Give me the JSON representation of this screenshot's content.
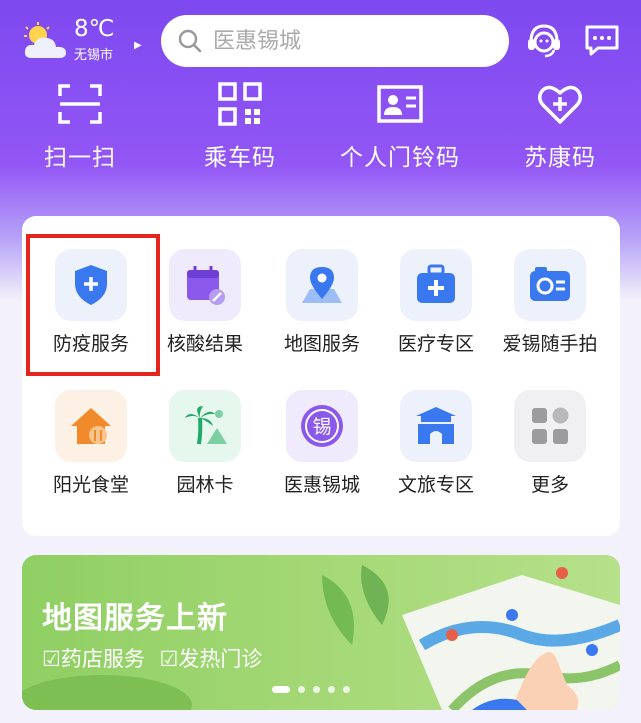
{
  "weather": {
    "temperature": "8℃",
    "city": "无锡市"
  },
  "search": {
    "placeholder": "医惠锡城"
  },
  "quick_actions": [
    {
      "label": "扫一扫",
      "icon": "scan-icon"
    },
    {
      "label": "乘车码",
      "icon": "qr-code-icon"
    },
    {
      "label": "个人门铃码",
      "icon": "id-card-icon"
    },
    {
      "label": "苏康码",
      "icon": "health-heart-icon"
    }
  ],
  "services": [
    {
      "label": "防疫服务",
      "icon": "shield-plus-icon"
    },
    {
      "label": "核酸结果",
      "icon": "calendar-edit-icon"
    },
    {
      "label": "地图服务",
      "icon": "map-pin-icon"
    },
    {
      "label": "医疗专区",
      "icon": "medical-kit-icon"
    },
    {
      "label": "爱锡随手拍",
      "icon": "camera-card-icon"
    },
    {
      "label": "阳光食堂",
      "icon": "house-dining-icon"
    },
    {
      "label": "园林卡",
      "icon": "palm-tree-icon"
    },
    {
      "label": "医惠锡城",
      "icon": "xi-badge-icon"
    },
    {
      "label": "文旅专区",
      "icon": "gate-tower-icon"
    },
    {
      "label": "更多",
      "icon": "more-grid-icon"
    }
  ],
  "banner": {
    "title": "地图服务上新",
    "tags": [
      "☑药店服务",
      "☑发热门诊"
    ],
    "page_count": 5,
    "active_page": 1
  },
  "colors": {
    "primary": "#8450f2",
    "icon_blue": "#3a78f0",
    "highlight": "#e3251e",
    "banner_green": "#9ad36c"
  }
}
